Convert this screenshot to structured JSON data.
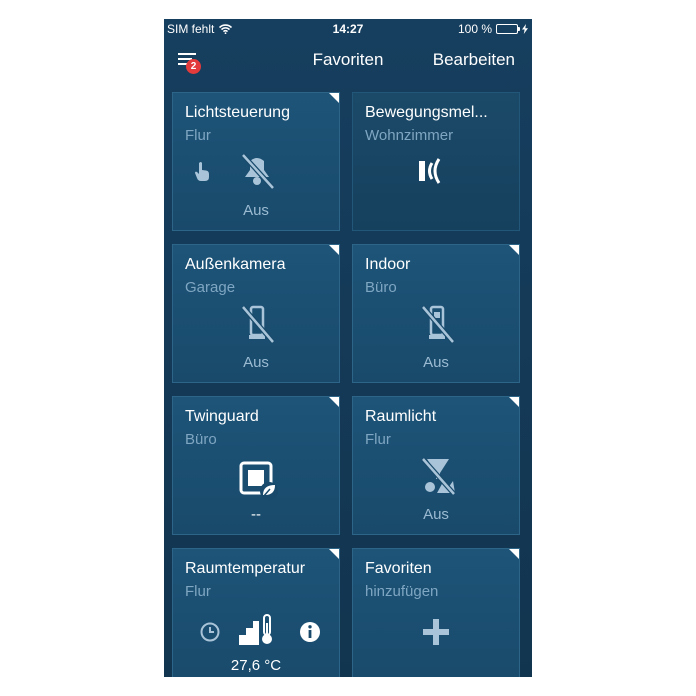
{
  "status_bar": {
    "carrier": "SIM fehlt",
    "time": "14:27",
    "battery": "100 %"
  },
  "nav": {
    "notification_count": "2",
    "title": "Favoriten",
    "edit_label": "Bearbeiten"
  },
  "tiles": [
    {
      "title": "Lichtsteuerung",
      "subtitle": "Flur",
      "status": "Aus",
      "icon": "light-off-icon"
    },
    {
      "title": "Bewegungsmel...",
      "subtitle": "Wohnzimmer",
      "status": "",
      "icon": "motion-sensor-icon"
    },
    {
      "title": "Außenkamera",
      "subtitle": "Garage",
      "status": "Aus",
      "icon": "camera-off-icon"
    },
    {
      "title": "Indoor",
      "subtitle": "Büro",
      "status": "Aus",
      "icon": "indoor-camera-off-icon"
    },
    {
      "title": "Twinguard",
      "subtitle": "Büro",
      "status": "--",
      "icon": "twinguard-icon"
    },
    {
      "title": "Raumlicht",
      "subtitle": "Flur",
      "status": "Aus",
      "icon": "room-light-off-icon"
    },
    {
      "title": "Raumtemperatur",
      "subtitle": "Flur",
      "status": "27,6 °C",
      "icon": "thermostat-icon"
    },
    {
      "title": "Favoriten",
      "subtitle": "hinzufügen",
      "status": "",
      "icon": "plus-icon"
    }
  ],
  "colors": {
    "background": "#143a58",
    "tile": "#1d5478",
    "subtitle": "#7fa6c2",
    "badge": "#e33b3b",
    "battery": "#4cd964"
  }
}
